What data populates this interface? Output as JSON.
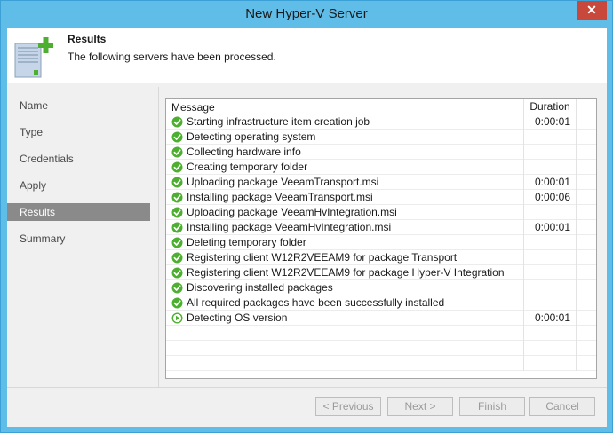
{
  "window": {
    "title": "New Hyper-V Server",
    "close_glyph": "✕"
  },
  "header": {
    "title": "Results",
    "description": "The following servers have been processed.",
    "icon": "server-add-icon"
  },
  "sidebar": {
    "items": [
      {
        "label": "Name",
        "active": false
      },
      {
        "label": "Type",
        "active": false
      },
      {
        "label": "Credentials",
        "active": false
      },
      {
        "label": "Apply",
        "active": false
      },
      {
        "label": "Results",
        "active": true
      },
      {
        "label": "Summary",
        "active": false
      }
    ]
  },
  "grid": {
    "columns": [
      "Message",
      "Duration"
    ],
    "rows": [
      {
        "message": "Starting infrastructure item creation job",
        "duration": "0:00:01",
        "status": "success"
      },
      {
        "message": "Detecting operating system",
        "duration": "",
        "status": "success"
      },
      {
        "message": "Collecting hardware info",
        "duration": "",
        "status": "success"
      },
      {
        "message": "Creating temporary folder",
        "duration": "",
        "status": "success"
      },
      {
        "message": "Uploading package VeeamTransport.msi",
        "duration": "0:00:01",
        "status": "success"
      },
      {
        "message": "Installing package VeeamTransport.msi",
        "duration": "0:00:06",
        "status": "success"
      },
      {
        "message": "Uploading package VeeamHvIntegration.msi",
        "duration": "",
        "status": "success"
      },
      {
        "message": "Installing package VeeamHvIntegration.msi",
        "duration": "0:00:01",
        "status": "success"
      },
      {
        "message": "Deleting temporary folder",
        "duration": "",
        "status": "success"
      },
      {
        "message": "Registering client W12R2VEEAM9 for package Transport",
        "duration": "",
        "status": "success"
      },
      {
        "message": "Registering client W12R2VEEAM9 for package Hyper-V Integration",
        "duration": "",
        "status": "success"
      },
      {
        "message": "Discovering installed packages",
        "duration": "",
        "status": "success"
      },
      {
        "message": "All required packages have been successfully installed",
        "duration": "",
        "status": "success"
      },
      {
        "message": "Detecting OS version",
        "duration": "0:00:01",
        "status": "running"
      }
    ]
  },
  "footer": {
    "previous": "< Previous",
    "next": "Next >",
    "finish": "Finish",
    "cancel": "Cancel"
  },
  "colors": {
    "titlebar": "#5fbde8",
    "close": "#c9483c",
    "success": "#4caf30",
    "nav_active": "#8a8a8a"
  }
}
